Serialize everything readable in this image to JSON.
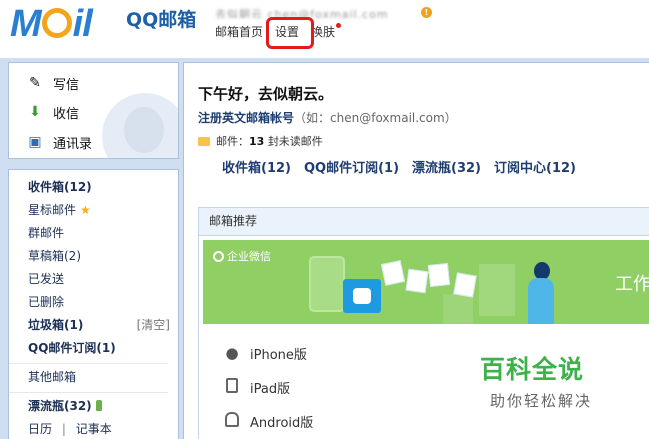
{
  "header": {
    "logo_text": "Mail",
    "product": "QQ邮箱",
    "account_obscured": "去似朝云 chen@foxmail.com",
    "nav": {
      "home": "邮箱首页",
      "settings": "设置",
      "skin": "换肤"
    }
  },
  "sidebar": {
    "actions": {
      "compose": "写信",
      "inbox": "收信",
      "contacts": "通讯录"
    },
    "folders": {
      "inbox": "收件箱(12)",
      "starred": "星标邮件",
      "group": "群邮件",
      "drafts": "草稿箱(2)",
      "sent": "已发送",
      "deleted": "已删除",
      "spam": "垃圾箱(1)",
      "spam_clear": "[清空]",
      "subscriptions": "QQ邮件订阅(1)",
      "other": "其他邮箱",
      "drift_bottle": "漂流瓶(32)",
      "calendar": "日历",
      "separator": "|",
      "notes": "记事本"
    }
  },
  "main": {
    "greeting_prefix": "下午好，",
    "greeting_name": "去似朝云。",
    "register_link": "注册英文邮箱帐号",
    "register_hint_open": "（如：",
    "register_hint_email": "chen@foxmail.com",
    "register_hint_close": "）",
    "unread_prefix": "邮件：",
    "unread_count": "13",
    "unread_suffix": "封未读邮件",
    "quick_links": [
      "收件箱(12)",
      "QQ邮件订阅(1)",
      "漂流瓶(32)",
      "订阅中心(12)"
    ],
    "recommend": {
      "title": "邮箱推荐",
      "banner_label": "企业微信",
      "banner_title": "工作",
      "platforms": [
        "iPhone版",
        "iPad版",
        "Android版"
      ]
    }
  },
  "watermark": {
    "main": "百科全说",
    "sub": "助你轻松解决"
  },
  "colors": {
    "frame": "#cfdef0",
    "accent": "#1e3e72",
    "banner": "#8fcf63",
    "highlight": "#e21b1b"
  }
}
